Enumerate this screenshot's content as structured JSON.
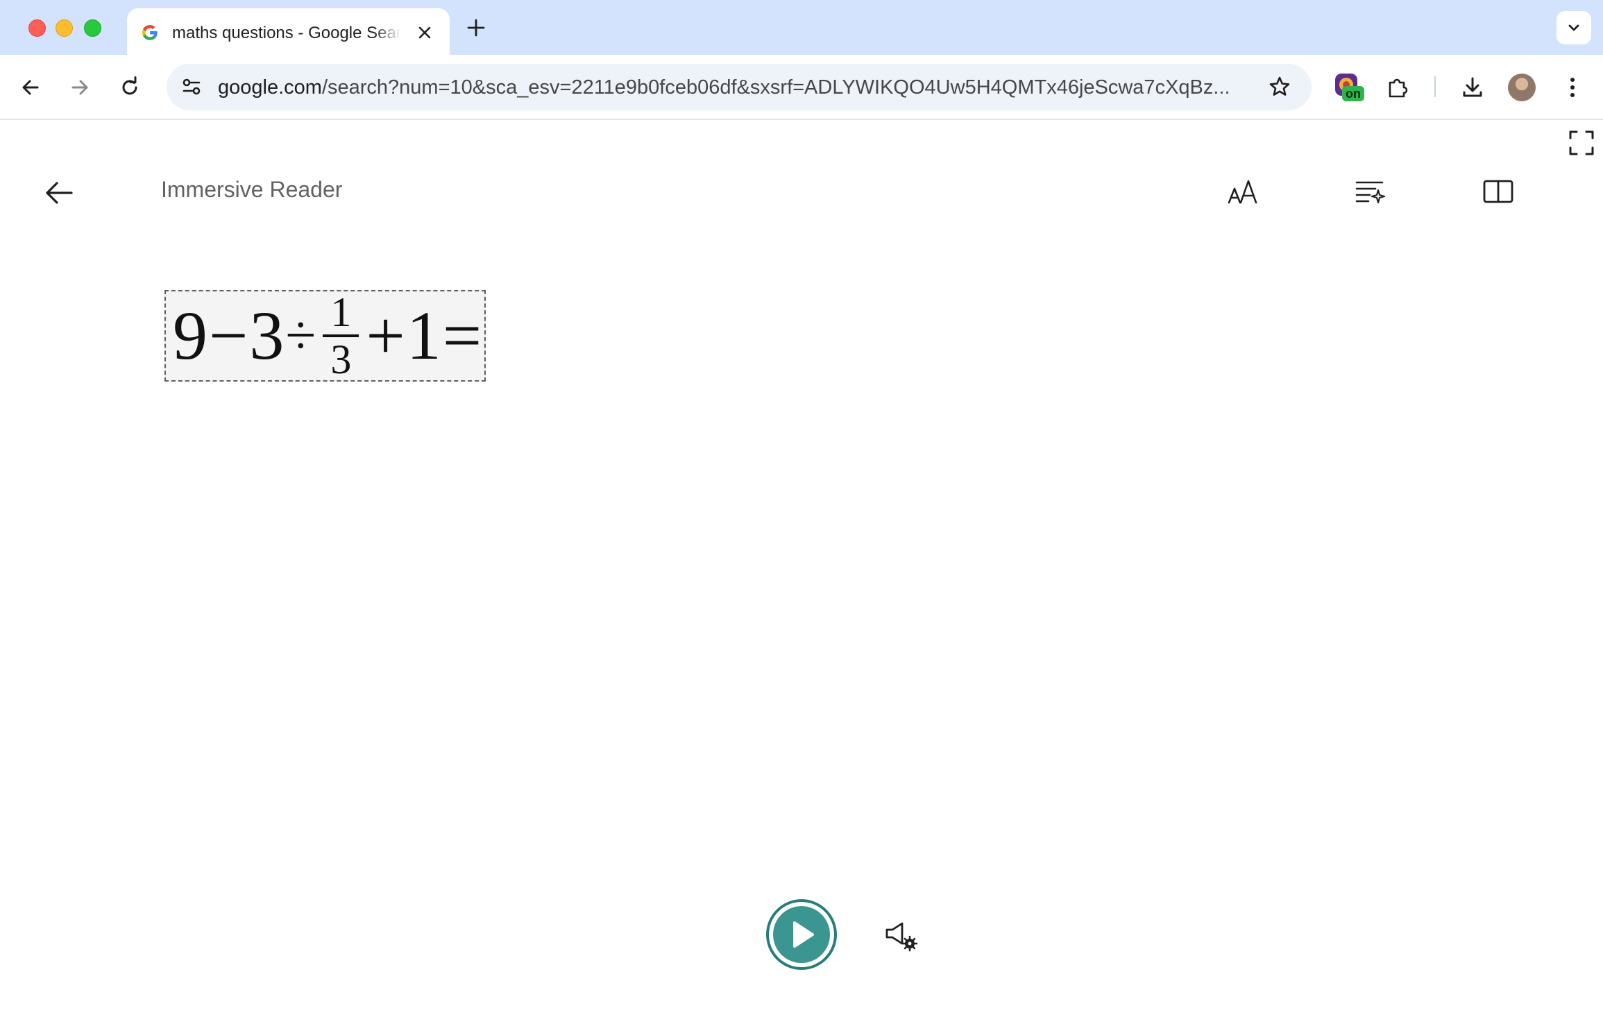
{
  "browser": {
    "tab": {
      "title": "maths questions - Google Search",
      "favicon": "google-g-icon"
    },
    "url": {
      "host": "google.com",
      "path": "/search?num=10&sca_esv=2211e9b0fceb06df&sxsrf=ADLYWIKQO4Uw5H4QMTx46jeScwa7cXqBz..."
    },
    "extension_badge": "on",
    "icons": {
      "back": "back-arrow-icon",
      "forward": "forward-arrow-icon",
      "reload": "reload-icon",
      "site_settings": "tune-icon",
      "bookmark": "star-icon",
      "extensions": "puzzle-icon",
      "downloads": "download-icon",
      "menu": "kebab-menu-icon"
    }
  },
  "reader": {
    "title": "Immersive Reader",
    "toolbar": [
      "text-preferences",
      "grammar-options",
      "reading-preferences"
    ],
    "equation": {
      "a": "9",
      "op1": "−",
      "b": "3",
      "op2": "÷",
      "frac_num": "1",
      "frac_den": "3",
      "op3": "+",
      "c": "1",
      "eq": "="
    }
  },
  "colors": {
    "tabstrip": "#d3e3fd",
    "omnibox": "#eef2f9",
    "play_accent": "#3b9590",
    "play_ring": "#267d7b",
    "extension_badge": "#2fb34d"
  }
}
